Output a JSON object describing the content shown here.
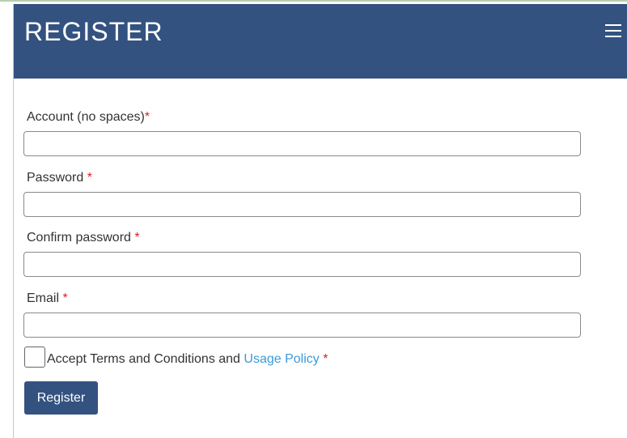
{
  "header": {
    "title": "REGISTER",
    "menu_icon": "hamburger-menu-icon",
    "background_color": "#34527f"
  },
  "form": {
    "account": {
      "label": "Account (no spaces)",
      "required_mark": "*",
      "value": ""
    },
    "password": {
      "label": "Password",
      "required_mark": "*",
      "value": ""
    },
    "confirm_password": {
      "label": "Confirm password",
      "required_mark": "*",
      "value": ""
    },
    "email": {
      "label": "Email",
      "required_mark": "*",
      "value": ""
    },
    "terms": {
      "checked": false,
      "text": "Accept Terms and Conditions and ",
      "link_text": "Usage Policy",
      "required_mark": "*",
      "link_color": "#3a9ad9"
    },
    "submit_label": "Register"
  },
  "colors": {
    "required": "#e02020",
    "button": "#34527f"
  }
}
